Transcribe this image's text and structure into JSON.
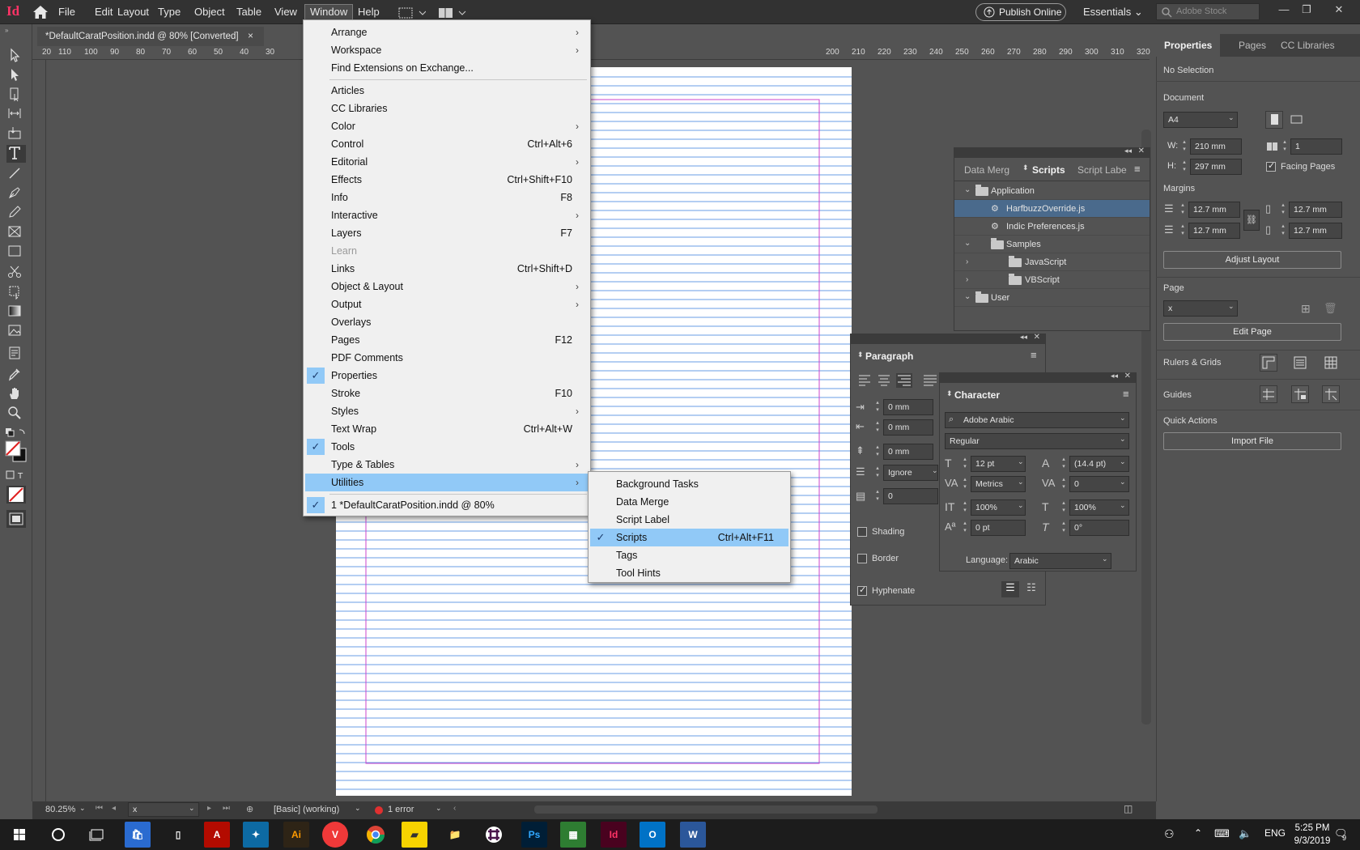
{
  "app": {
    "logo": "Id",
    "menus": [
      "File",
      "Edit",
      "Layout",
      "Type",
      "Object",
      "Table",
      "View",
      "Window",
      "Help"
    ],
    "active_menu": "Window",
    "publish_label": "Publish Online",
    "workspace": "Essentials",
    "stock_placeholder": "Adobe Stock"
  },
  "document_tab": {
    "title": "*DefaultCaratPosition.indd @ 80% [Converted]",
    "close": "×"
  },
  "window_menu": {
    "items": [
      {
        "label": "Arrange",
        "submenu": true
      },
      {
        "label": "Workspace",
        "submenu": true
      },
      {
        "label": "Find Extensions on Exchange..."
      },
      {
        "label": "Articles"
      },
      {
        "label": "CC Libraries"
      },
      {
        "label": "Color",
        "submenu": true
      },
      {
        "label": "Control",
        "shortcut": "Ctrl+Alt+6"
      },
      {
        "label": "Editorial",
        "submenu": true
      },
      {
        "label": "Effects",
        "shortcut": "Ctrl+Shift+F10"
      },
      {
        "label": "Info",
        "shortcut": "F8"
      },
      {
        "label": "Interactive",
        "submenu": true
      },
      {
        "label": "Layers",
        "shortcut": "F7"
      },
      {
        "label": "Learn",
        "disabled": true
      },
      {
        "label": "Links",
        "shortcut": "Ctrl+Shift+D"
      },
      {
        "label": "Object & Layout",
        "submenu": true
      },
      {
        "label": "Output",
        "submenu": true
      },
      {
        "label": "Overlays"
      },
      {
        "label": "Pages",
        "shortcut": "F12"
      },
      {
        "label": "PDF Comments"
      },
      {
        "label": "Properties",
        "checked": true
      },
      {
        "label": "Stroke",
        "shortcut": "F10"
      },
      {
        "label": "Styles",
        "submenu": true
      },
      {
        "label": "Text Wrap",
        "shortcut": "Ctrl+Alt+W"
      },
      {
        "label": "Tools",
        "checked": true
      },
      {
        "label": "Type & Tables",
        "submenu": true
      },
      {
        "label": "Utilities",
        "submenu": true,
        "highlighted": true
      },
      {
        "label": "1 *DefaultCaratPosition.indd @ 80%",
        "checked": true
      }
    ]
  },
  "utilities_menu": {
    "items": [
      {
        "label": "Background Tasks"
      },
      {
        "label": "Data Merge"
      },
      {
        "label": "Script Label"
      },
      {
        "label": "Scripts",
        "shortcut": "Ctrl+Alt+F11",
        "checked": true,
        "highlighted": true
      },
      {
        "label": "Tags"
      },
      {
        "label": "Tool Hints"
      }
    ]
  },
  "scripts_panel": {
    "tabs": [
      "Data Merg",
      "Scripts",
      "Script Labe"
    ],
    "active_tab": "Scripts",
    "tree": [
      {
        "label": "Application",
        "expanded": true,
        "folder": true
      },
      {
        "label": "HarfbuzzOverride.js",
        "selected": true
      },
      {
        "label": "Indic Preferences.js"
      },
      {
        "label": "Samples",
        "expanded": true,
        "folder": true
      },
      {
        "label": "JavaScript",
        "folder": true
      },
      {
        "label": "VBScript",
        "folder": true
      },
      {
        "label": "User",
        "expanded": true,
        "folder": true
      }
    ]
  },
  "paragraph_panel": {
    "title": "Paragraph",
    "indent_left": "0 mm",
    "first_indent": "0 mm",
    "space_before": "0 mm",
    "align_grid": "Ignore",
    "drop_cap": "0",
    "shading_label": "Shading",
    "border_label": "Border",
    "hyphenate_label": "Hyphenate",
    "hyphenate_checked": true
  },
  "character_panel": {
    "title": "Character",
    "font": "Adobe Arabic",
    "style": "Regular",
    "size": "12 pt",
    "leading": "(14.4 pt)",
    "kerning": "Metrics",
    "tracking": "0",
    "vscale": "100%",
    "hscale": "100%",
    "baseline": "0 pt",
    "skew": "0°",
    "language_label": "Language:",
    "language": "Arabic"
  },
  "properties_panel": {
    "tabs": [
      "Properties",
      "Pages",
      "CC Libraries"
    ],
    "active_tab": "Properties",
    "selection": "No Selection",
    "document_label": "Document",
    "page_size": "A4",
    "width_label": "W:",
    "width": "210 mm",
    "height_label": "H:",
    "height": "297 mm",
    "pages": "1",
    "facing_pages_label": "Facing Pages",
    "facing_pages": true,
    "margins_label": "Margins",
    "margin_top": "12.7 mm",
    "margin_bottom": "12.7 mm",
    "margin_inside": "12.7 mm",
    "margin_outside": "12.7 mm",
    "adjust_layout": "Adjust Layout",
    "page_label": "Page",
    "page_value": "x",
    "edit_page": "Edit Page",
    "rulers_grids": "Rulers & Grids",
    "guides": "Guides",
    "quick_actions": "Quick Actions",
    "import_file": "Import File"
  },
  "status_bar": {
    "zoom": "80.25%",
    "page": "x",
    "style": "[Basic] (working)",
    "errors": "1 error"
  },
  "ruler_h_labels": [
    "20",
    "110",
    "100",
    "90",
    "80",
    "70",
    "60",
    "50",
    "40",
    "30",
    "200",
    "210",
    "220",
    "230",
    "240",
    "250",
    "260",
    "270",
    "280",
    "290",
    "300",
    "310",
    "320"
  ],
  "taskbar": {
    "time": "5:25 PM",
    "date": "9/3/2019",
    "language": "ENG",
    "notification_count": "9"
  },
  "colors": {
    "accent_highlight": "#91c9f7",
    "selection_row": "#4a6a8c",
    "indesign_brand": "#ff3366",
    "margin_guide": "#cc44cc",
    "baseline_grid": "#6a9ee6"
  }
}
